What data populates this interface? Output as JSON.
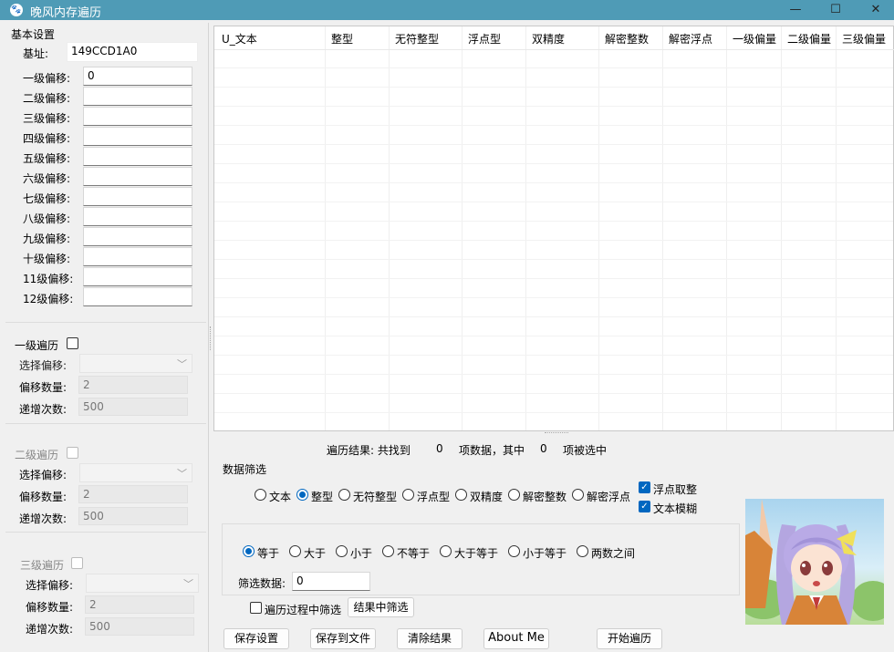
{
  "window": {
    "title": "晚风内存遍历",
    "minimize": "—",
    "maximize": "☐",
    "close": "✕"
  },
  "basic": {
    "group_label": "基本设置",
    "base_label": "基址:",
    "base_value": "149CCD1A0",
    "offsets": [
      {
        "label": "一级偏移:",
        "value": "0"
      },
      {
        "label": "二级偏移:",
        "value": ""
      },
      {
        "label": "三级偏移:",
        "value": ""
      },
      {
        "label": "四级偏移:",
        "value": ""
      },
      {
        "label": "五级偏移:",
        "value": ""
      },
      {
        "label": "六级偏移:",
        "value": ""
      },
      {
        "label": "七级偏移:",
        "value": ""
      },
      {
        "label": "八级偏移:",
        "value": ""
      },
      {
        "label": "九级偏移:",
        "value": ""
      },
      {
        "label": "十级偏移:",
        "value": ""
      },
      {
        "label": "11级偏移:",
        "value": ""
      },
      {
        "label": "12级偏移:",
        "value": ""
      }
    ]
  },
  "traverse": [
    {
      "title": "一级遍历",
      "select_label": "选择偏移:",
      "count_label": "偏移数量:",
      "count": "2",
      "inc_label": "递增次数:",
      "inc": "500"
    },
    {
      "title": "二级遍历",
      "select_label": "选择偏移:",
      "count_label": "偏移数量:",
      "count": "2",
      "inc_label": "递增次数:",
      "inc": "500"
    },
    {
      "title": "三级遍历",
      "select_label": "选择偏移:",
      "count_label": "偏移数量:",
      "count": "2",
      "inc_label": "递增次数:",
      "inc": "500"
    }
  ],
  "grid": {
    "columns": [
      "U_文本",
      "整型",
      "无符整型",
      "浮点型",
      "双精度",
      "解密整数",
      "解密浮点",
      "一级偏量",
      "二级偏量",
      "三级偏量"
    ]
  },
  "status": {
    "prefix": "遍历结果:  共找到",
    "found": "0",
    "middle": "项数据，其中",
    "selected": "0",
    "suffix": "项被选中"
  },
  "filter": {
    "group_label": "数据筛选",
    "types": [
      "文本",
      "整型",
      "无符整型",
      "浮点型",
      "双精度",
      "解密整数",
      "解密浮点"
    ],
    "selected_type": "整型",
    "float_round": "浮点取整",
    "text_fuzzy": "文本模糊",
    "compare": [
      "等于",
      "大于",
      "小于",
      "不等于",
      "大于等于",
      "小于等于",
      "两数之间"
    ],
    "selected_compare": "等于",
    "filter_data_label": "筛选数据:",
    "filter_data_value": "0",
    "filter_during_label": "遍历过程中筛选",
    "filter_results_btn": "结果中筛选"
  },
  "buttons": {
    "save_settings": "保存设置",
    "save_to_file": "保存到文件",
    "clear_results": "清除结果",
    "about": "About Me",
    "start": "开始遍历"
  },
  "colors": {
    "titlebar": "#4f9bb6",
    "accent": "#0067c0"
  }
}
